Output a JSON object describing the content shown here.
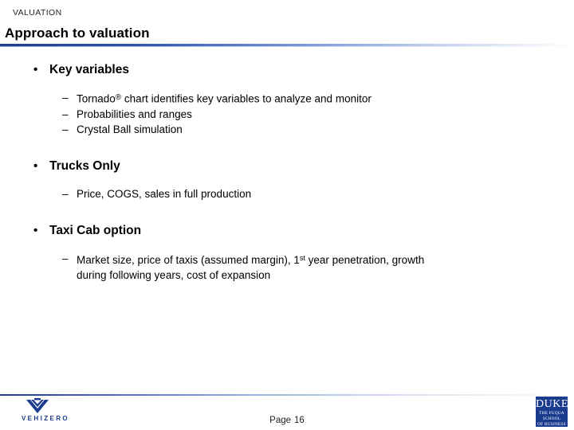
{
  "header": {
    "eyebrow": "VALUATION",
    "title": "Approach to valuation"
  },
  "body": {
    "sections": [
      {
        "bullet_glyph": "•",
        "heading": "Key variables",
        "items": [
          {
            "dash": "–",
            "text_before": "Tornado",
            "sup": "®",
            "text_after": " chart identifies key variables to analyze and monitor"
          },
          {
            "dash": "–",
            "text": "Probabilities and ranges"
          },
          {
            "dash": "–",
            "text": "Crystal Ball simulation"
          }
        ]
      },
      {
        "bullet_glyph": "•",
        "heading": "Trucks Only",
        "items": [
          {
            "dash": "–",
            "text": "Price, COGS, sales in full production"
          }
        ]
      },
      {
        "bullet_glyph": "•",
        "heading": "Taxi Cab option",
        "items": [
          {
            "dash": "–",
            "text_before": "Market size, price of taxis (assumed margin), 1",
            "sup": "st",
            "text_after": " year penetration, growth",
            "continuation": "during following years, cost of expansion"
          }
        ]
      }
    ]
  },
  "footer": {
    "page_label": "Page",
    "page_number": "16",
    "left_logo": {
      "wordmark": "VEHIZERO",
      "icon": "vehizero-v-mark"
    },
    "right_logo": {
      "line1": "DUKE",
      "line2": "THE FUQUA",
      "line3": "SCHOOL",
      "line4": "OF BUSINESS"
    }
  },
  "colors": {
    "accent_blue": "#1b3b8f",
    "text": "#000000"
  }
}
